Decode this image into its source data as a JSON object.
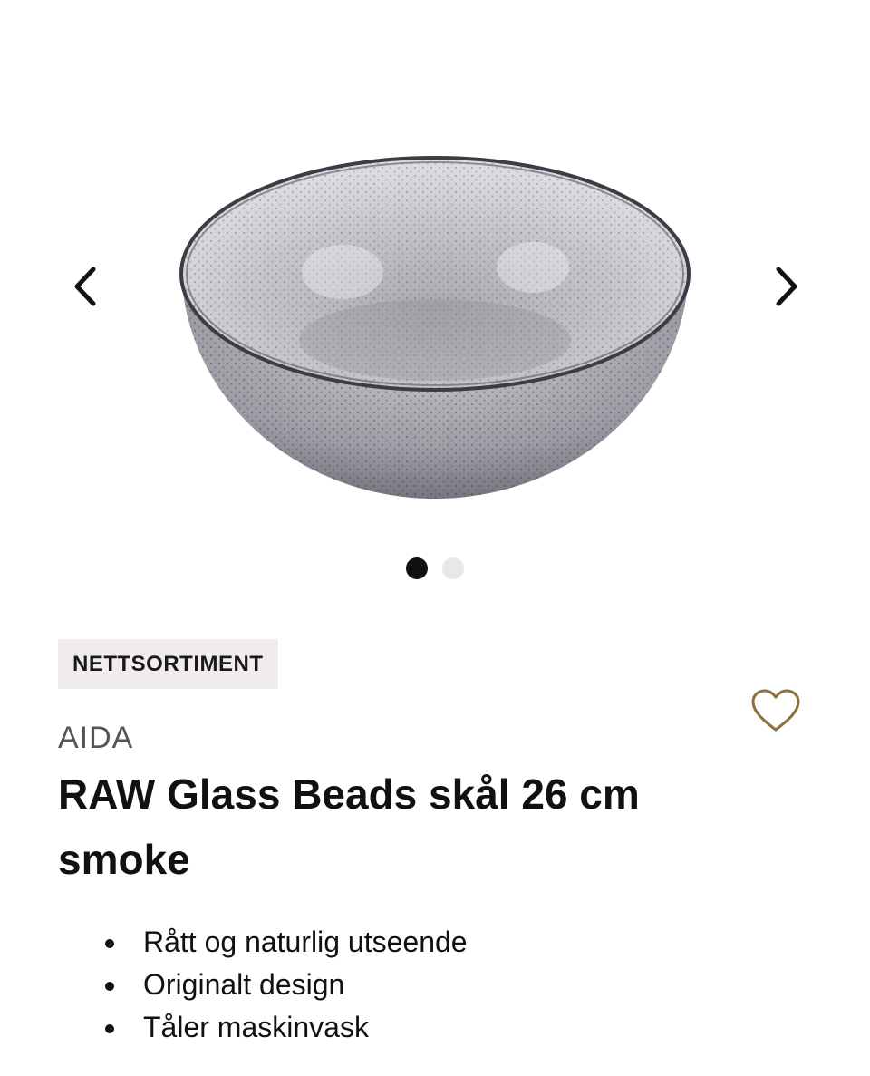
{
  "gallery": {
    "prev_icon": "chevron-left-icon",
    "next_icon": "chevron-right-icon",
    "image_count": 2,
    "active_index": 0
  },
  "product": {
    "badge": "NETTSORTIMENT",
    "brand": "AIDA",
    "title": "RAW Glass Beads skål 26 cm smoke",
    "favorite_icon": "heart-outline-icon",
    "features": [
      "Rått og naturlig utseende",
      "Originalt design",
      "Tåler maskinvask"
    ]
  },
  "colors": {
    "favorite_icon": "#8b6f3e",
    "badge_bg": "#f1eded",
    "dot_active": "#111111",
    "dot_inactive": "#e9e7e7"
  }
}
